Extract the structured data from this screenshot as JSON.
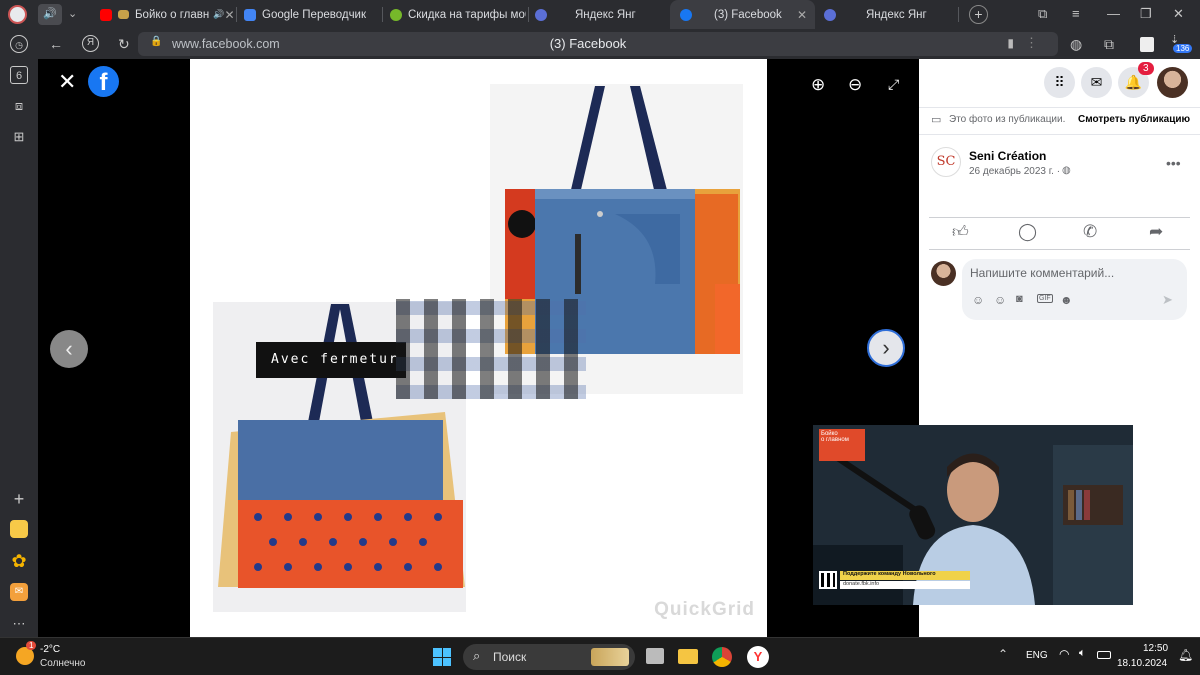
{
  "browser": {
    "tabs": [
      {
        "title": "Бойко о главн",
        "active": false
      },
      {
        "title": "Google Переводчик",
        "active": false
      },
      {
        "title": "Скидка на тарифы моб",
        "active": false
      },
      {
        "title": "Яндекс Янг",
        "active": false
      },
      {
        "title": "(3) Facebook",
        "active": true
      },
      {
        "title": "Яндекс Янг",
        "active": false
      }
    ],
    "url": "www.facebook.com",
    "page_title": "(3) Facebook",
    "sidebar_badge": "6",
    "ext_badge": "136"
  },
  "photo": {
    "overlay_text": "Avec fermetur",
    "watermark": "QuickGrid"
  },
  "fb": {
    "notif_count": "3",
    "post_notice": "Это фото из публикации.",
    "view_post": "Смотреть публикацию",
    "author": "Seni Création",
    "author_logo": "SC",
    "date": "26 декабрь 2023 г. ·",
    "comment_placeholder": "Напишите комментарий..."
  },
  "pip": {
    "badge_line1": "Бойко",
    "badge_line2": "о главном",
    "banner": "Поддержите команду Новольного",
    "banner_url": "donate.fbk.info"
  },
  "taskbar": {
    "weather_temp": "-2°C",
    "weather_desc": "Солнечно",
    "weather_badge": "1",
    "search": "Поиск",
    "lang": "ENG",
    "time": "12:50",
    "date": "18.10.2024"
  },
  "colors": {
    "fb_blue": "#1877f2",
    "chrome_dark": "#2b2c30",
    "notif_red": "#e41e3f"
  }
}
